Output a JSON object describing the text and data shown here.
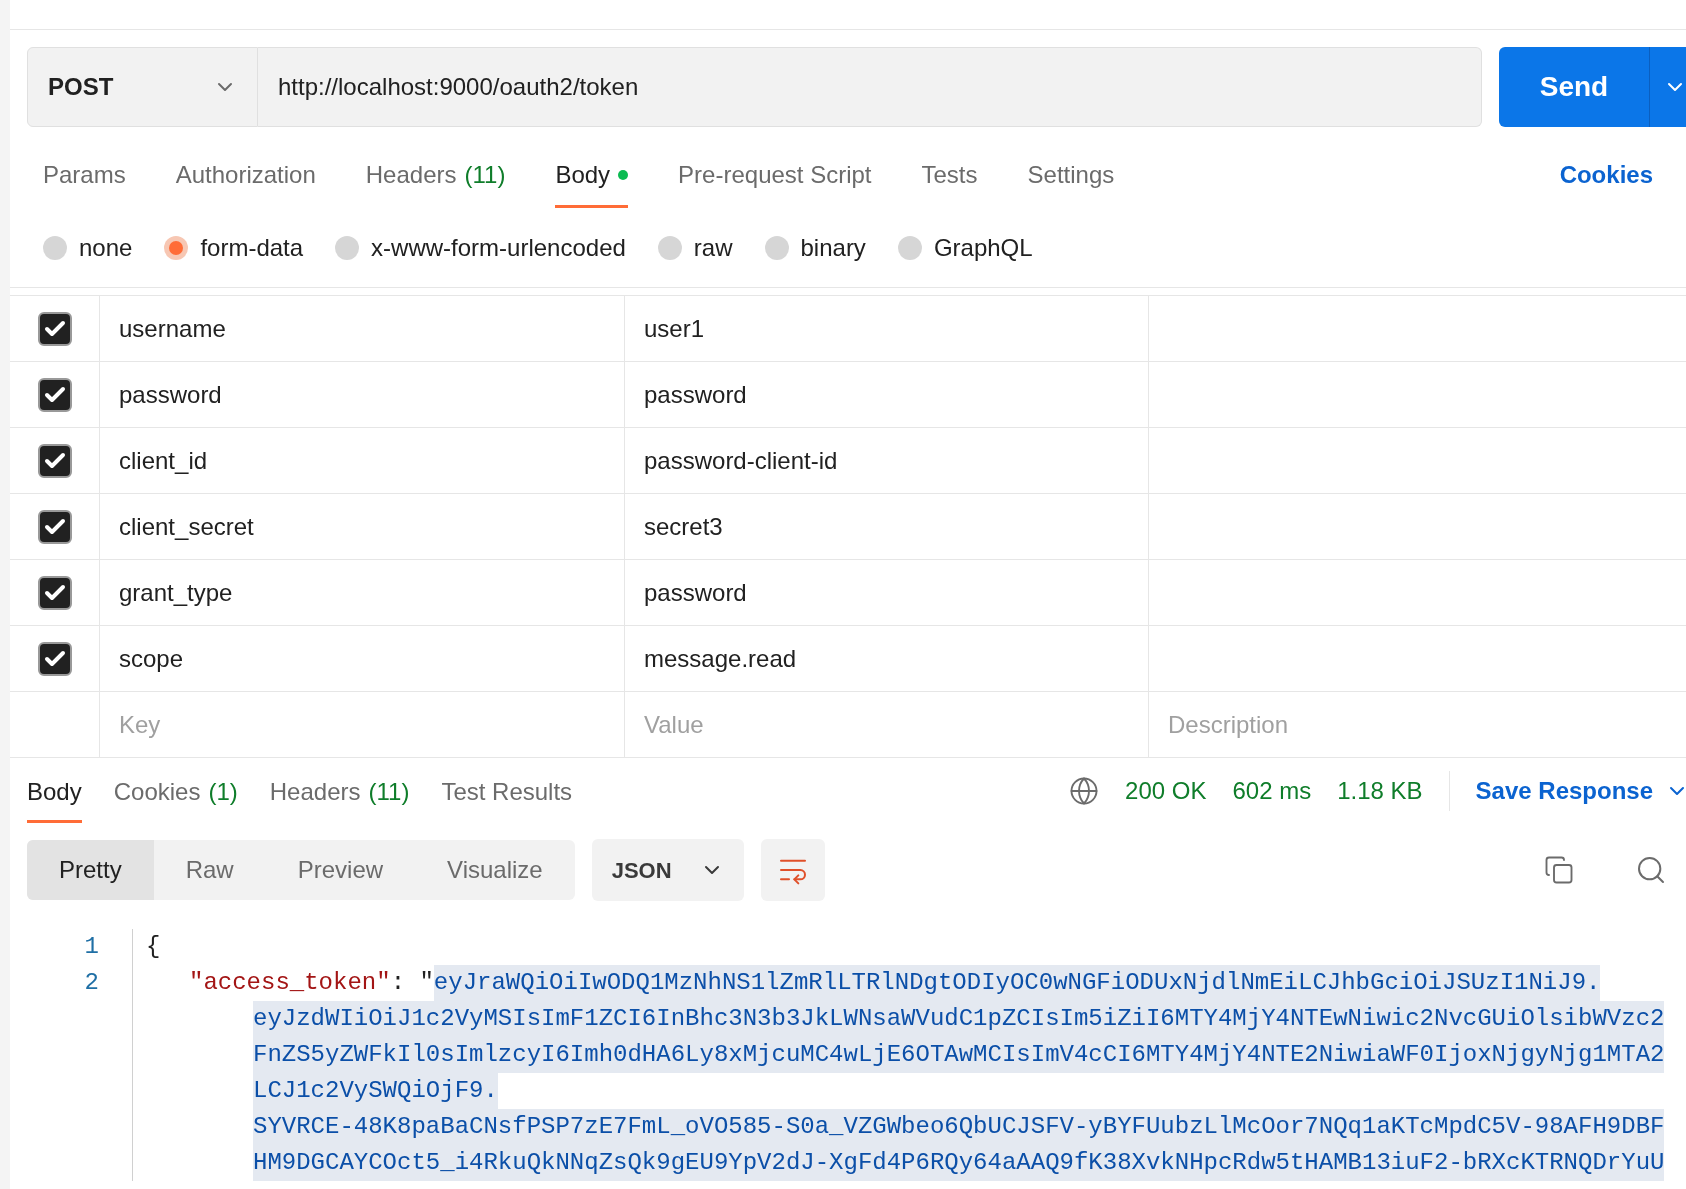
{
  "request": {
    "method": "POST",
    "url": "http://localhost:9000/oauth2/token",
    "send_label": "Send"
  },
  "request_tabs": [
    {
      "label": "Params",
      "selected": false
    },
    {
      "label": "Authorization",
      "selected": false
    },
    {
      "label": "Headers",
      "count": "(11)",
      "selected": false
    },
    {
      "label": "Body",
      "selected": true,
      "has_content": true
    },
    {
      "label": "Pre-request Script",
      "selected": false
    },
    {
      "label": "Tests",
      "selected": false
    },
    {
      "label": "Settings",
      "selected": false
    }
  ],
  "cookies_link": "Cookies",
  "body_types": [
    {
      "label": "none",
      "selected": false
    },
    {
      "label": "form-data",
      "selected": true
    },
    {
      "label": "x-www-form-urlencoded",
      "selected": false
    },
    {
      "label": "raw",
      "selected": false
    },
    {
      "label": "binary",
      "selected": false
    },
    {
      "label": "GraphQL",
      "selected": false
    }
  ],
  "params": [
    {
      "key": "username",
      "value": "user1",
      "checked": true
    },
    {
      "key": "password",
      "value": "password",
      "checked": true
    },
    {
      "key": "client_id",
      "value": "password-client-id",
      "checked": true
    },
    {
      "key": "client_secret",
      "value": "secret3",
      "checked": true
    },
    {
      "key": "grant_type",
      "value": "password",
      "checked": true
    },
    {
      "key": "scope",
      "value": "message.read",
      "checked": true
    }
  ],
  "new_row": {
    "key_placeholder": "Key",
    "value_placeholder": "Value",
    "description_placeholder": "Description"
  },
  "response": {
    "tabs": [
      {
        "label": "Body",
        "selected": true
      },
      {
        "label": "Cookies",
        "count": "(1)",
        "selected": false
      },
      {
        "label": "Headers",
        "count": "(11)",
        "selected": false
      },
      {
        "label": "Test Results",
        "selected": false
      }
    ],
    "status": "200 OK",
    "time": "602 ms",
    "size": "1.18 KB",
    "save_label": "Save Response",
    "view_modes": [
      {
        "label": "Pretty",
        "selected": true
      },
      {
        "label": "Raw",
        "selected": false
      },
      {
        "label": "Preview",
        "selected": false
      },
      {
        "label": "Visualize",
        "selected": false
      }
    ],
    "format": "JSON"
  },
  "code": [
    {
      "number": "1",
      "text": "{"
    },
    {
      "number": "2",
      "key": "\"access_token\"",
      "sep": ": \"",
      "value_lines": [
        "eyJraWQiOiIwODQ1MzNhNS1lZmRlLTRlNDgtODIyOC0wNGFiODUxNjdlNmEiLCJhbGciOiJSUzI1NiJ9.",
        "eyJzdWIiOiJ1c2VyMSIsImF1ZCI6InBhc3N3b3JkLWNsaWVudC1pZCIsIm5iZiI6MTY4MjY4NTEwNiwic2NvcGUiOlsibWVzc2",
        "FnZS5yZWFkIl0sImlzcyI6Imh0dHA6Ly8xMjcuMC4wLjE6OTAwMCIsImV4cCI6MTY4MjY4NTE2NiwiaWF0IjoxNjgyNjg1MTA2",
        "LCJ1c2VySWQiOjF9.",
        "SYVRCE-48K8paBaCNsfPSP7zE7FmL_oVO585-S0a_VZGWbeo6QbUCJSFV-yBYFUubzLlMcOor7NQq1aKTcMpdC5V-98AFH9DBF",
        "HM9DGCAYCOct5_i4RkuQkNNqZsQk9gEU9YpV2dJ-XgFd4P6RQy64aAAQ9fK38XvkNHpcRdw5tHAMB13iuF2-bRXcKTRNQDrYuU"
      ]
    }
  ]
}
